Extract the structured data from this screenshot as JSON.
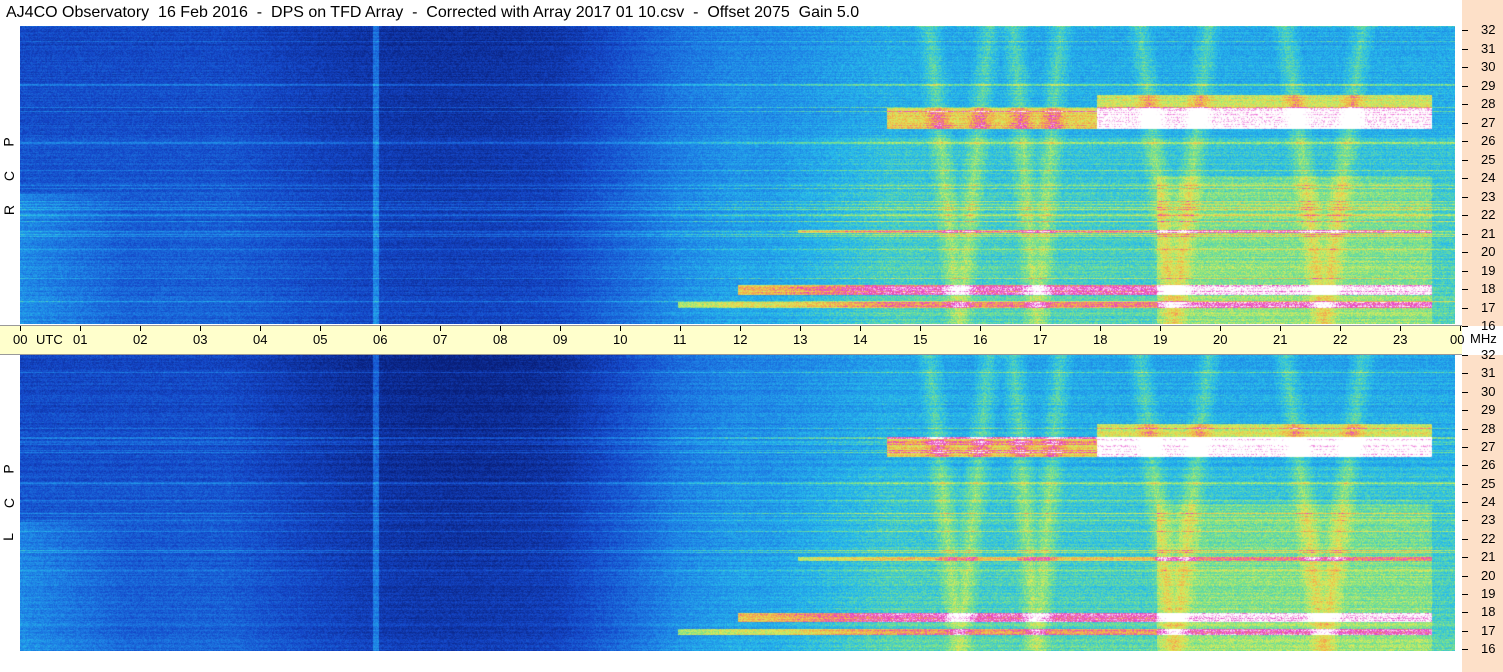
{
  "title": "AJ4CO Observatory  16 Feb 2016  -  DPS on TFD Array  -  Corrected with Array 2017 01 10.csv  -  Offset 2075  Gain 5.0",
  "panels": {
    "top_label": [
      "R",
      "C",
      "P"
    ],
    "bottom_label": [
      "L",
      "C",
      "P"
    ]
  },
  "axes": {
    "time_ticks": [
      "00",
      "01",
      "02",
      "03",
      "04",
      "05",
      "06",
      "07",
      "08",
      "09",
      "10",
      "11",
      "12",
      "13",
      "14",
      "15",
      "16",
      "17",
      "18",
      "19",
      "20",
      "21",
      "22",
      "23",
      "00"
    ],
    "time_unit": "UTC",
    "freq_ticks": [
      "16",
      "17",
      "18",
      "19",
      "20",
      "21",
      "22",
      "23",
      "24",
      "25",
      "26",
      "27",
      "28",
      "29",
      "30",
      "31",
      "32"
    ],
    "freq_unit": "MHz"
  },
  "colors": {
    "background_deep": "#0a2a9a",
    "background_mid": "#1a5ad0",
    "cyan": "#28b4e8",
    "green": "#8ee07a",
    "yellow": "#e8e860",
    "orange": "#f0a040",
    "magenta": "#e030d0",
    "white": "#ffffff",
    "time_axis_bg": "#ffffcc",
    "freq_axis_bg": "#fde0c8"
  },
  "chart_data": {
    "type": "heatmap",
    "title": "AJ4CO Observatory  16 Feb 2016  -  DPS on TFD Array  -  Corrected with Array 2017 01 10.csv  -  Offset 2075  Gain 5.0",
    "xlabel": "UTC",
    "ylabel": "MHz",
    "xlim": [
      0,
      24
    ],
    "ylim": [
      16,
      32
    ],
    "panels": [
      "RCP",
      "LCP"
    ],
    "features": [
      {
        "kind": "band",
        "freq": 27,
        "t_start": 14.5,
        "t_end": 23.5,
        "level": "high"
      },
      {
        "kind": "band",
        "freq": 17.8,
        "t_start": 12,
        "t_end": 23.5,
        "level": "high"
      },
      {
        "kind": "band",
        "freq": 17.1,
        "t_start": 11,
        "t_end": 23.5,
        "level": "medium"
      },
      {
        "kind": "vertical_line",
        "time": 5.95,
        "level": "medium"
      },
      {
        "kind": "region",
        "t_start": 14,
        "t_end": 16.5,
        "level": "medium"
      },
      {
        "kind": "region",
        "t_start": 19,
        "t_end": 23.5,
        "level": "high"
      }
    ]
  }
}
